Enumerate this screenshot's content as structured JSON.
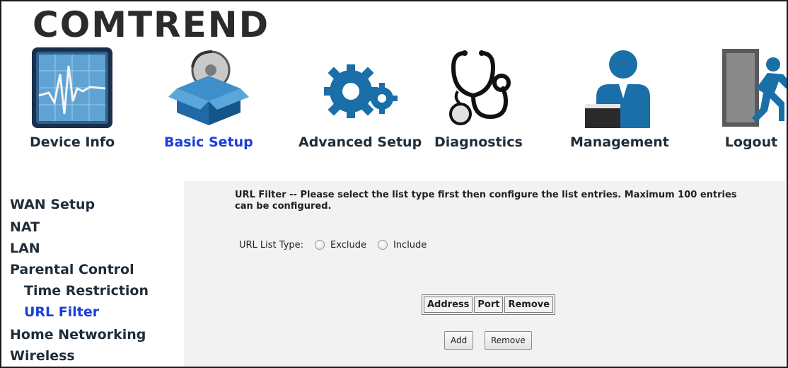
{
  "brand": {
    "name": "COMTREND"
  },
  "nav": [
    {
      "label": "Device Info",
      "icon": "monitor-chart-icon",
      "active": false
    },
    {
      "label": "Basic Setup",
      "icon": "box-disc-icon",
      "active": true
    },
    {
      "label": "Advanced Setup",
      "icon": "gears-icon",
      "active": false
    },
    {
      "label": "Diagnostics",
      "icon": "stethoscope-icon",
      "active": false
    },
    {
      "label": "Management",
      "icon": "user-admin-icon",
      "active": false
    },
    {
      "label": "Logout",
      "icon": "exit-runner-icon",
      "active": false
    }
  ],
  "sidebar": {
    "items": [
      {
        "label": "WAN Setup"
      },
      {
        "label": "NAT"
      },
      {
        "label": "LAN"
      },
      {
        "label": "Parental Control"
      },
      {
        "label": "Time Restriction"
      },
      {
        "label": "URL Filter"
      },
      {
        "label": "Home Networking"
      },
      {
        "label": "Wireless"
      }
    ]
  },
  "content": {
    "description": "URL Filter -- Please select the list type first then configure the list entries. Maximum 100 entries can be configured.",
    "list_type_label": "URL List Type:",
    "options": [
      {
        "label": "Exclude",
        "checked": false
      },
      {
        "label": "Include",
        "checked": false
      }
    ],
    "table": {
      "headers": [
        "Address",
        "Port",
        "Remove"
      ]
    },
    "buttons": {
      "add": "Add",
      "remove": "Remove"
    }
  },
  "colors": {
    "active": "#1a3ed8",
    "nav_text": "#1f2d3a",
    "content_bg": "#f2f2f2",
    "icon_blue": "#1a6fa8"
  }
}
